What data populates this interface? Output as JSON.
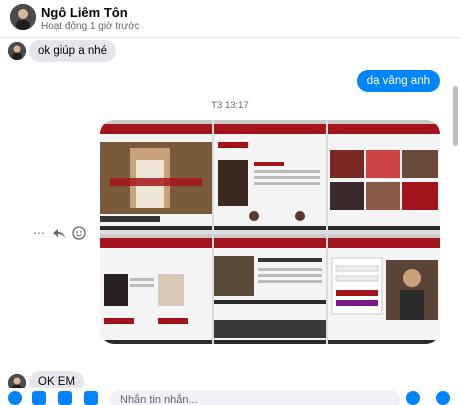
{
  "header": {
    "name": "Ngô Liêm Tôn",
    "status": "Hoạt động 1 giờ trước"
  },
  "messages": {
    "incoming_1": "ok giúp a nhé",
    "outgoing_1": "dạ vâng anh",
    "timestamp": "T3 13:17",
    "incoming_2": "OK EM"
  },
  "composer": {
    "placeholder": "Nhắn tin nhắn..."
  },
  "colors": {
    "accent": "#0084ff",
    "site_red": "#a3151b"
  },
  "icons": {
    "more": "more-icon",
    "reply": "reply-icon",
    "react": "emoji-icon"
  }
}
